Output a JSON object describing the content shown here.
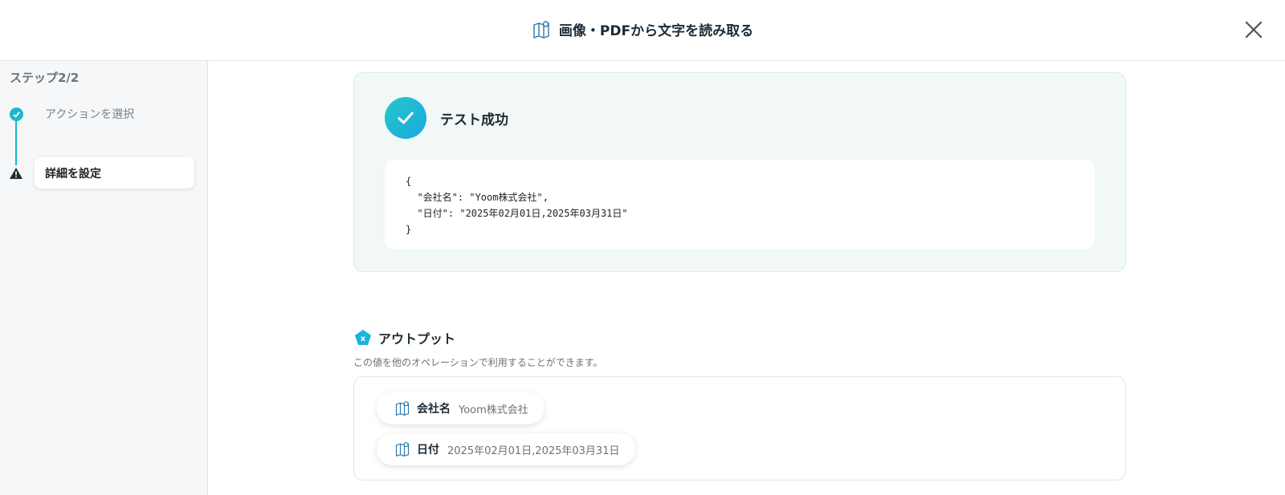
{
  "header": {
    "title": "画像・PDFから文字を読み取る",
    "icon": "document-ocr-icon"
  },
  "sidebar": {
    "step_label": "ステップ2/2",
    "steps": [
      {
        "label": "アクションを選択",
        "status": "completed"
      },
      {
        "label": "詳細を設定",
        "status": "warning"
      }
    ]
  },
  "test": {
    "status_text": "テスト成功",
    "json_lines": [
      "{",
      "  \"会社名\": \"Yoom株式会社\",",
      "  \"日付\": \"2025年02月01日,2025年03月31日\"",
      "}"
    ]
  },
  "output": {
    "title": "アウトプット",
    "description": "この値を他のオペレーションで利用することができます。",
    "items": [
      {
        "key": "会社名",
        "value": "Yoom株式会社"
      },
      {
        "key": "日付",
        "value": "2025年02月01日,2025年03月31日"
      }
    ]
  },
  "colors": {
    "accent": "#1bb8c9",
    "success_panel_bg": "#f1f8f7"
  }
}
